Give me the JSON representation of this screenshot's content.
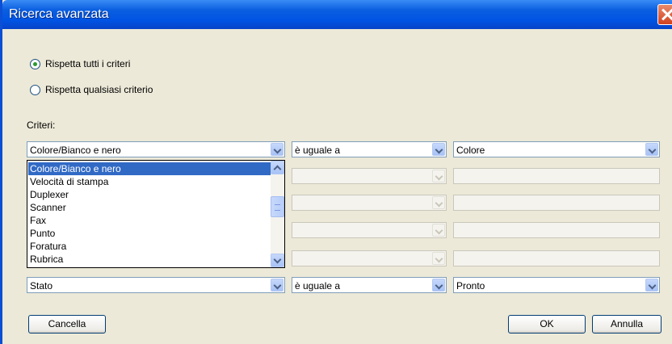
{
  "window": {
    "title": "Ricerca avanzata"
  },
  "match": {
    "all_label": "Rispetta tutti i criteri",
    "any_label": "Rispetta qualsiasi criterio",
    "selected": "all"
  },
  "criteria": {
    "label": "Criteri:",
    "row1": {
      "field": "Colore/Bianco e nero",
      "operator": "è uguale a",
      "value": "Colore"
    },
    "list_items": [
      "Colore/Bianco e nero",
      "Velocità di stampa",
      "Duplexer",
      "Scanner",
      "Fax",
      "Punto",
      "Foratura",
      "Rubrica"
    ],
    "row_last": {
      "field": "Stato",
      "operator": "è uguale a",
      "value": "Pronto"
    }
  },
  "buttons": {
    "clear": "Cancella",
    "ok": "OK",
    "cancel": "Annulla"
  }
}
